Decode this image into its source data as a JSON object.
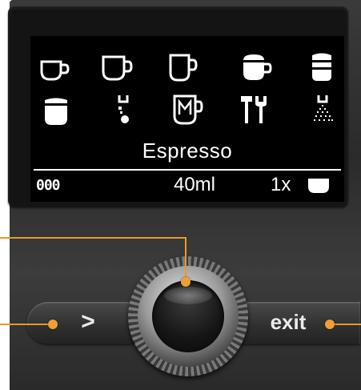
{
  "display": {
    "drink_name": "Espresso",
    "strength_indicator": "000",
    "volume": "40ml",
    "cup_count": "1x"
  },
  "icons": [
    {
      "name": "espresso-cup-icon"
    },
    {
      "name": "coffee-cup-icon"
    },
    {
      "name": "large-cup-icon"
    },
    {
      "name": "cappuccino-icon"
    },
    {
      "name": "latte-macchiato-icon"
    },
    {
      "name": "milk-cup-icon"
    },
    {
      "name": "hot-water-icon"
    },
    {
      "name": "menu-mug-icon"
    },
    {
      "name": "tools-icon"
    },
    {
      "name": "steam-icon"
    }
  ],
  "controls": {
    "left_button_label": ">",
    "right_button_label": "exit"
  },
  "colors": {
    "callout": "#e8992a",
    "screen_bg": "#000000",
    "screen_fg": "#ffffff"
  }
}
